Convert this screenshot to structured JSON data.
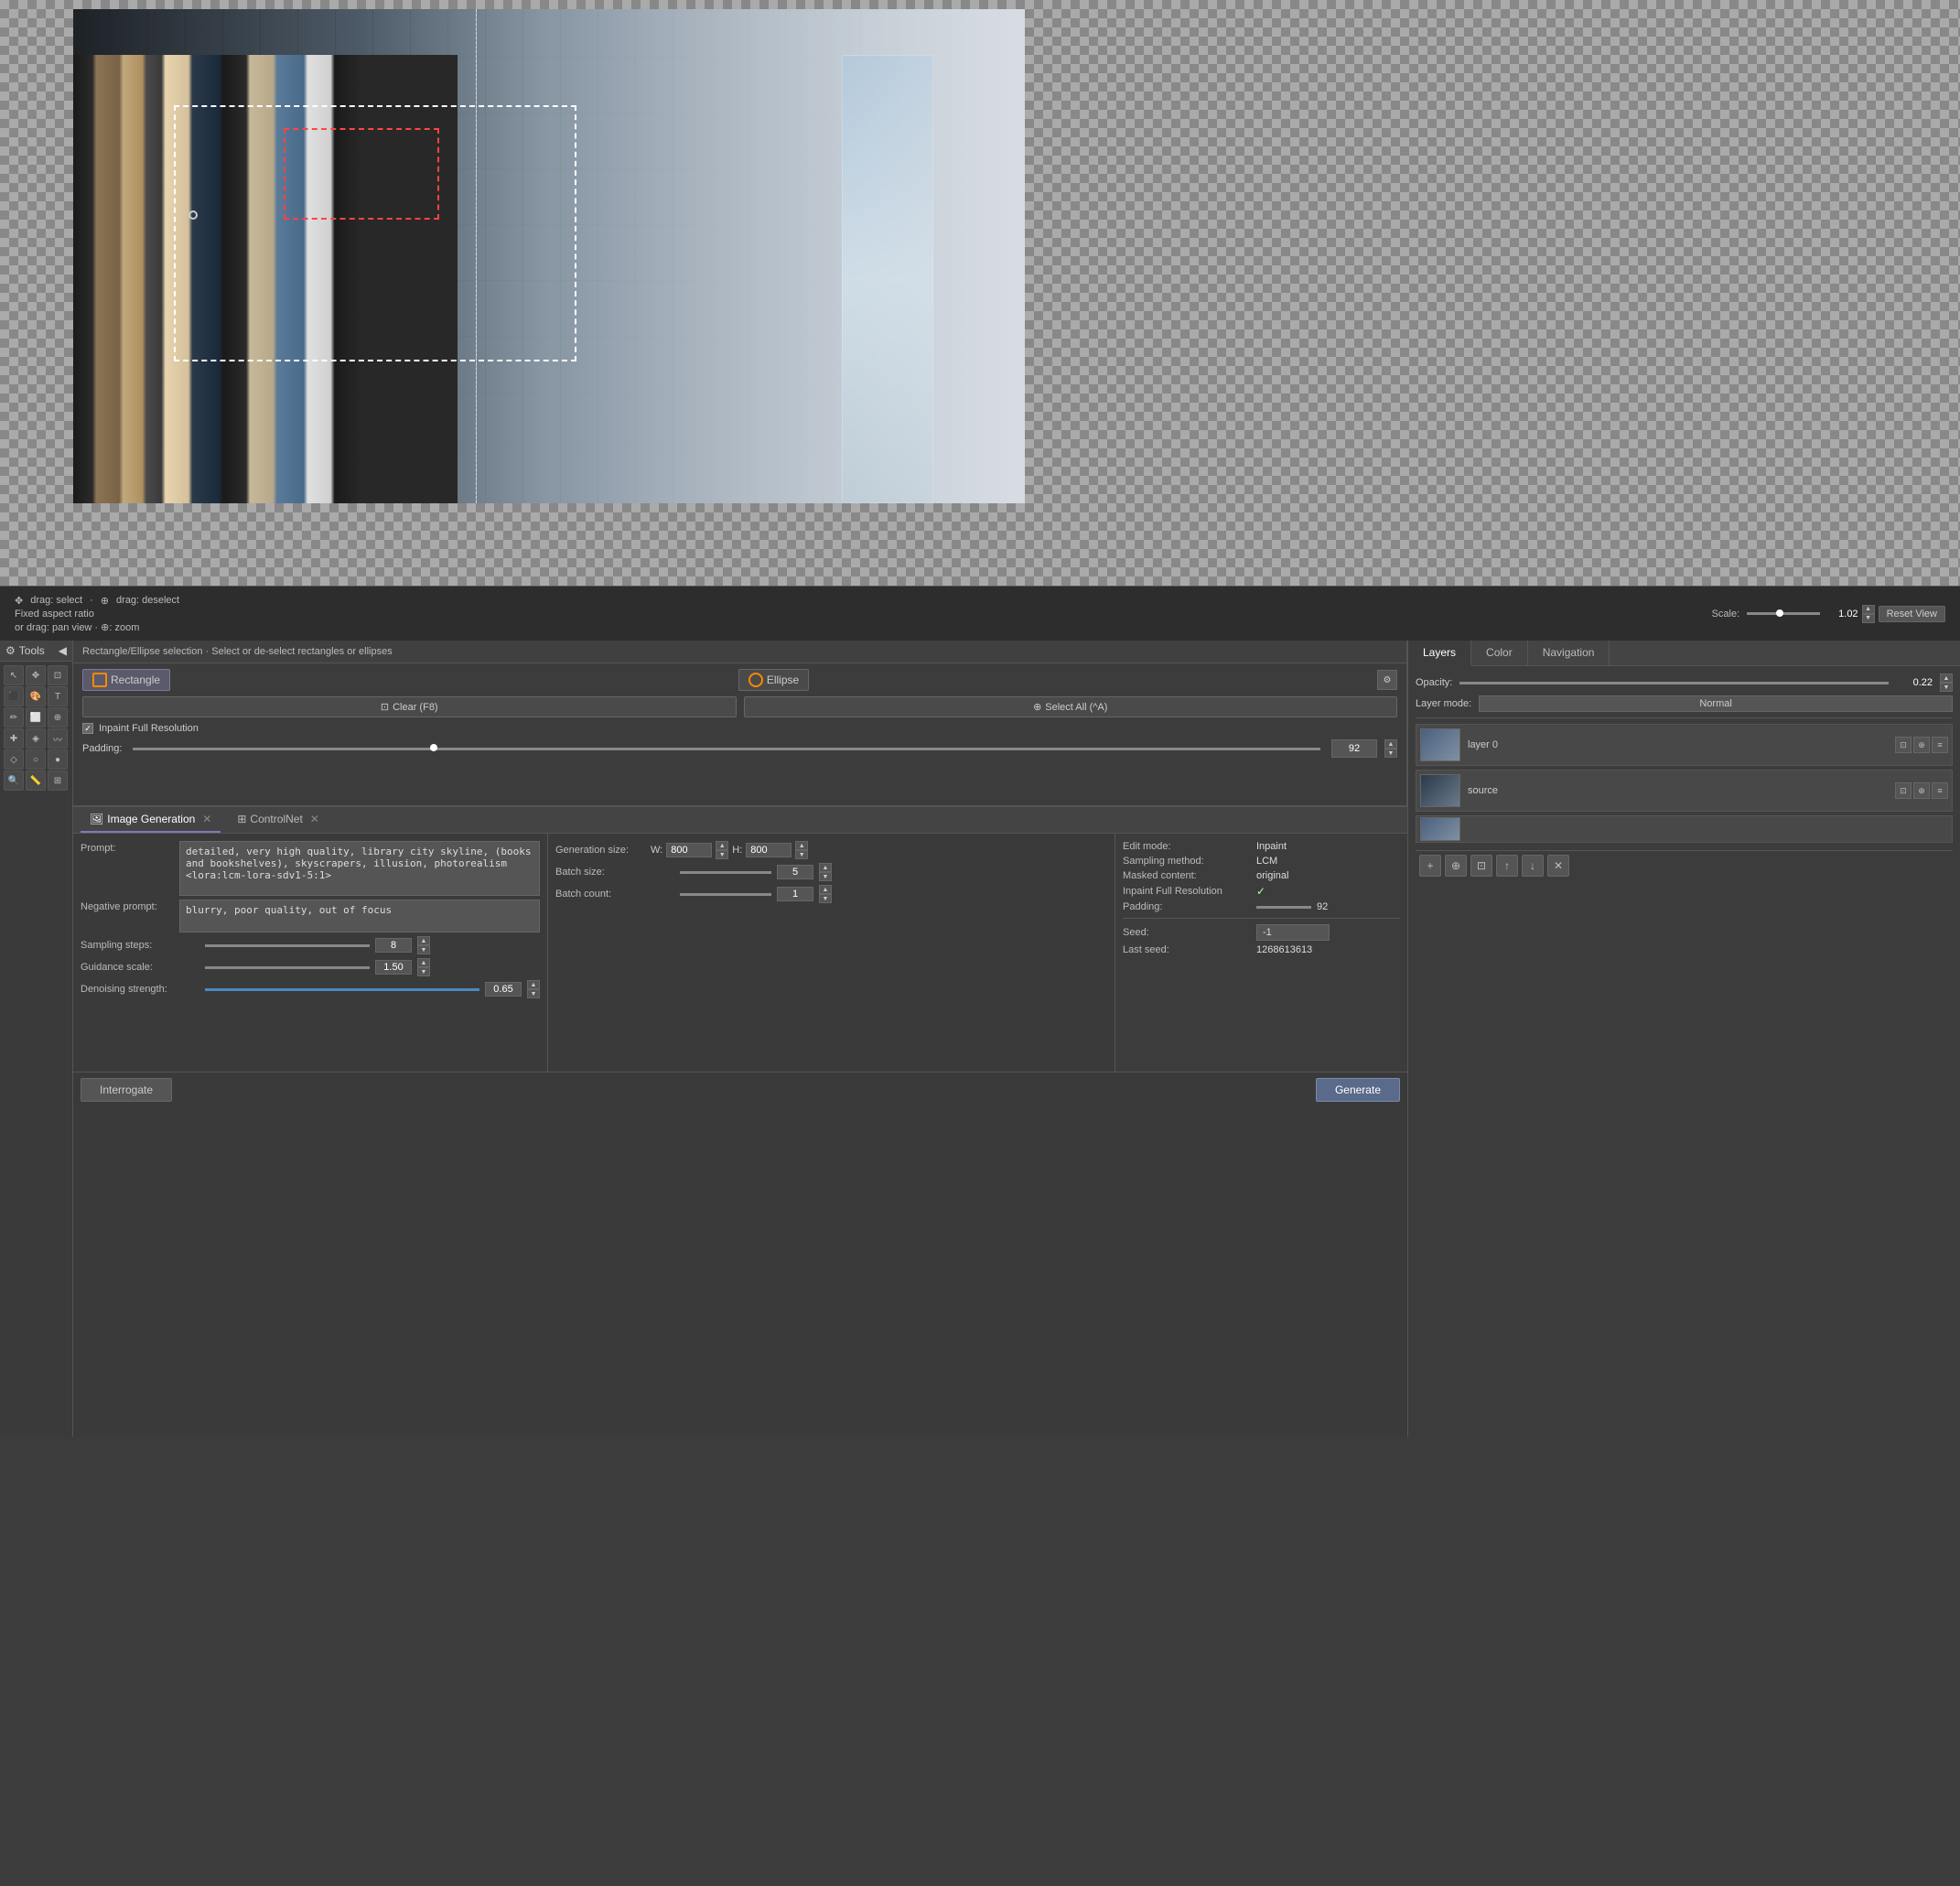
{
  "canvas": {
    "zoom": "1.02",
    "reset_label": "Reset View",
    "scale_label": "Scale:"
  },
  "status_bar": {
    "drag_select": "drag: select",
    "drag_deselect": "drag: deselect",
    "fixed_aspect": "Fixed aspect ratio",
    "pan_zoom": "or drag: pan view  ·  ⊕: zoom"
  },
  "tools": {
    "header_label": "Tools",
    "collapse_label": "◀"
  },
  "selection": {
    "header_label": "Rectangle/Ellipse selection · Select or de-select rectangles or ellipses",
    "rectangle_label": "Rectangle",
    "ellipse_label": "Ellipse",
    "clear_label": "Clear (F8)",
    "select_all_label": "Select All (^A)",
    "inpaint_full_res_label": "Inpaint Full Resolution",
    "inpaint_checked": true,
    "padding_label": "Padding:",
    "padding_value": "92"
  },
  "layers": {
    "layers_tab": "Layers",
    "color_tab": "Color",
    "navigation_tab": "Navigation",
    "opacity_label": "Opacity:",
    "opacity_value": "0.22",
    "layer_mode_label": "Layer mode:",
    "layer_mode_value": "Normal",
    "layer0_name": "layer 0",
    "source_name": "source"
  },
  "generation": {
    "image_gen_tab": "Image Generation",
    "controlnet_tab": "ControlNet",
    "prompt_label": "Prompt:",
    "prompt_value": "detailed, very high quality, library city skyline, (books and bookshelves), skyscrapers, illusion, photorealism <lora:lcm-lora-sdv1-5:1>",
    "negative_prompt_label": "Negative prompt:",
    "negative_prompt_value": "blurry, poor quality, out of focus",
    "sampling_steps_label": "Sampling steps:",
    "sampling_steps_value": "8",
    "guidance_scale_label": "Guidance scale:",
    "guidance_scale_value": "1.50",
    "denoising_strength_label": "Denoising strength:",
    "denoising_strength_value": "0.65",
    "gen_size_label": "Generation size:",
    "gen_size_w_label": "W:",
    "gen_size_w_value": "800",
    "gen_size_h_label": "H:",
    "gen_size_h_value": "800",
    "batch_size_label": "Batch size:",
    "batch_size_value": "5",
    "batch_count_label": "Batch count:",
    "batch_count_value": "1",
    "edit_mode_label": "Edit mode:",
    "edit_mode_value": "Inpaint",
    "sampling_method_label": "Sampling method:",
    "sampling_method_value": "LCM",
    "masked_content_label": "Masked content:",
    "masked_content_value": "original",
    "inpaint_full_res_label": "Inpaint Full Resolution",
    "inpaint_check": "✓",
    "padding_label": "Padding:",
    "padding_value": "92",
    "seed_label": "Seed:",
    "seed_value": "-1",
    "last_seed_label": "Last seed:",
    "last_seed_value": "1268613613",
    "interrogate_btn": "Interrogate",
    "generate_btn": "Generate"
  }
}
